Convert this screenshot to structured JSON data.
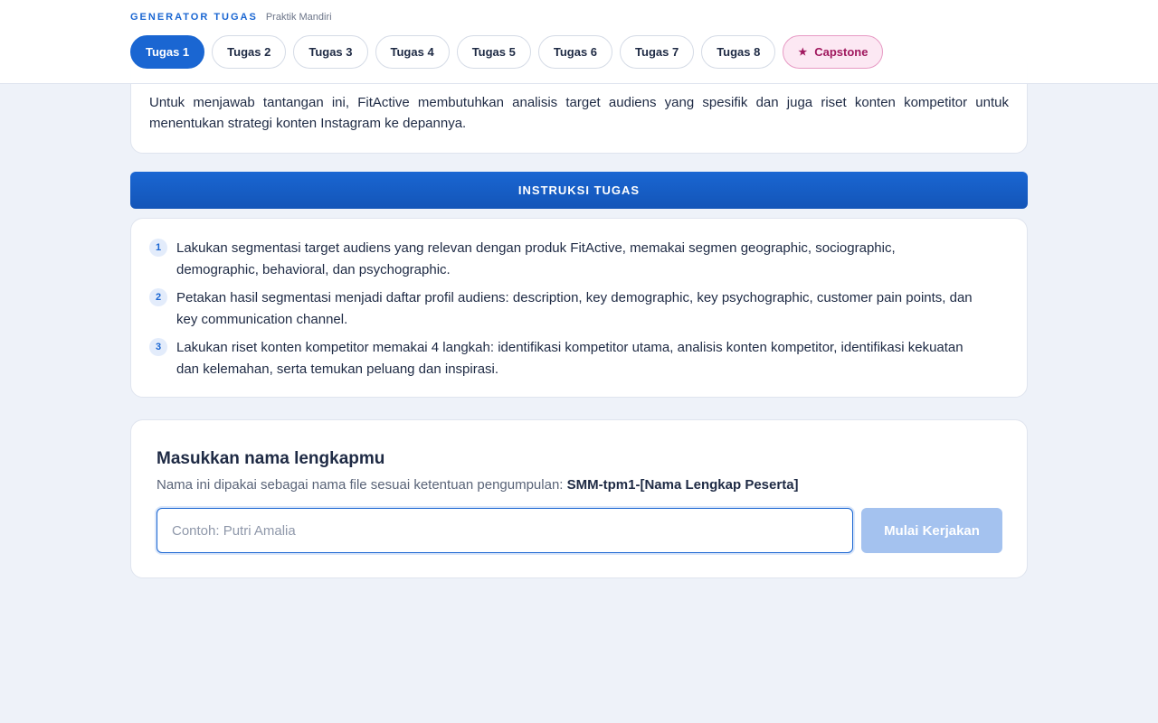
{
  "header": {
    "brand": "GENERATOR TUGAS",
    "subtitle": "Praktik Mandiri",
    "tabs": [
      {
        "label": "Tugas 1",
        "active": true
      },
      {
        "label": "Tugas 2"
      },
      {
        "label": "Tugas 3"
      },
      {
        "label": "Tugas 4"
      },
      {
        "label": "Tugas 5"
      },
      {
        "label": "Tugas 6"
      },
      {
        "label": "Tugas 7"
      },
      {
        "label": "Tugas 8"
      }
    ],
    "capstone": {
      "label": "Capstone",
      "icon": "star-icon"
    }
  },
  "context": {
    "text": "Untuk menjawab tantangan ini, FitActive membutuhkan analisis target audiens yang spesifik dan juga riset konten kompetitor untuk menentukan strategi konten Instagram ke depannya."
  },
  "instructions": {
    "title": "INSTRUKSI TUGAS",
    "steps": [
      {
        "num": "1",
        "text": "Lakukan segmentasi target audiens yang relevan dengan produk FitActive, memakai segmen geographic, sociographic, demographic, behavioral, dan psychographic."
      },
      {
        "num": "2",
        "text": "Petakan hasil segmentasi menjadi daftar profil audiens: description, key demographic, key psychographic, customer pain points, dan key communication channel."
      },
      {
        "num": "3",
        "text": "Lakukan riset konten kompetitor memakai 4 langkah: identifikasi kompetitor utama, analisis konten kompetitor, identifikasi kekuatan dan kelemahan, serta temukan peluang dan inspirasi."
      }
    ]
  },
  "name_form": {
    "title": "Masukkan nama lengkapmu",
    "desc_prefix": "Nama ini dipakai sebagai nama file sesuai ketentuan pengumpulan:",
    "desc_format": "SMM-tpm1-[Nama Lengkap Peserta]",
    "input_value": "",
    "input_placeholder": "Contoh: Putri Amalia",
    "button_label": "Mulai Kerjakan"
  },
  "colors": {
    "accent": "#1a66d2",
    "capstone_bg": "#fce8f3",
    "capstone_text": "#a0185e",
    "button_disabled": "#a4c2ef",
    "background": "#eef2f9"
  }
}
